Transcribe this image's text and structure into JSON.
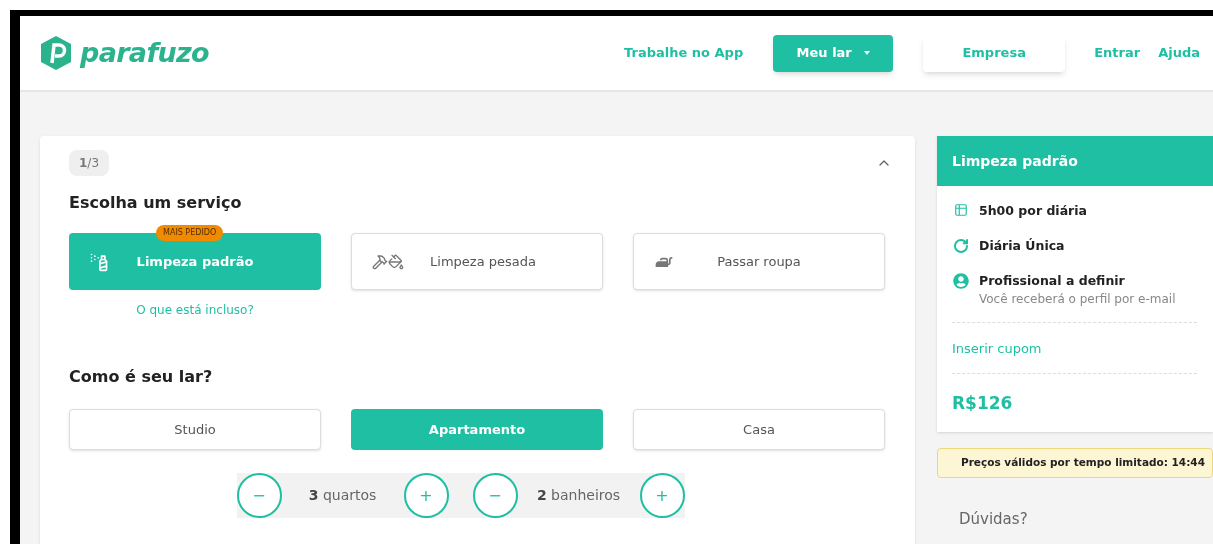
{
  "header": {
    "logo": "parafuzo",
    "nav": [
      {
        "kind": "link",
        "label": "Trabalhe no App"
      },
      {
        "kind": "dropdown",
        "label": "Meu lar"
      },
      {
        "kind": "outlined",
        "label": "Empresa"
      },
      {
        "kind": "link",
        "label": "Entrar"
      },
      {
        "kind": "link",
        "label": "Ajuda"
      }
    ]
  },
  "step": {
    "label": "**1**/3",
    "expanded": true
  },
  "service_section": {
    "title": "Escolha um serviço",
    "options": [
      {
        "kind": "spray",
        "label": "Limpeza padrão",
        "selected": true,
        "badge": "MAIS PEDIDO"
      },
      {
        "kind": "tools",
        "label": "Limpeza pesada",
        "selected": false
      },
      {
        "kind": "iron",
        "label": "Passar roupa",
        "selected": false
      }
    ],
    "link": "O que está incluso?"
  },
  "home_section": {
    "title": "Como é seu lar?",
    "options": [
      {
        "label": "Studio",
        "selected": false
      },
      {
        "label": "Apartamento",
        "selected": true
      },
      {
        "label": "Casa",
        "selected": false
      }
    ],
    "counters": [
      {
        "count": "3",
        "unit": "quartos",
        "minus": "−",
        "plus": "+"
      },
      {
        "count": "2",
        "unit": "banheiros",
        "minus": "−",
        "plus": "+"
      }
    ]
  },
  "summary": {
    "title": "Limpeza padrão",
    "items": [
      {
        "kind": "duration",
        "label": "5h00 por diária"
      },
      {
        "kind": "frequency",
        "label": "Diária Única"
      },
      {
        "kind": "professional",
        "label": "Profissional a definir",
        "detail": "Você receberá o perfil por e-mail"
      }
    ],
    "coupon": "Inserir cupom",
    "price": "R$126"
  },
  "notice": "Preços válidos por tempo limitado: 14:44",
  "help_title": "Dúvidas?"
}
